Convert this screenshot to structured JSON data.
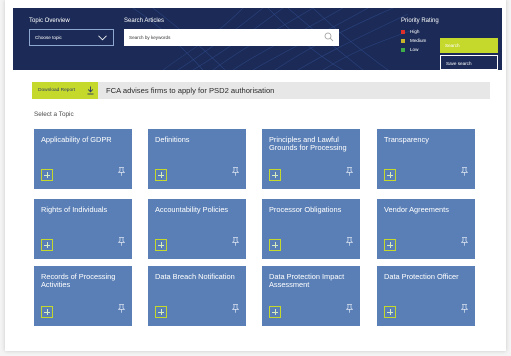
{
  "header": {
    "topic_label": "Topic Overview",
    "topic_select_value": "Choose topic",
    "search_label": "Search Articles",
    "search_placeholder": "Search by keywords",
    "priority_label": "Priority Rating",
    "priorities": [
      {
        "label": "High",
        "color": "#e0302c"
      },
      {
        "label": "Medium",
        "color": "#c8b42a"
      },
      {
        "label": "Low",
        "color": "#3fae4a"
      }
    ],
    "search_button": "Search",
    "save_search_button": "Save search"
  },
  "news": {
    "download_label": "Download Report",
    "headline": "FCA advises firms to apply for PSD2 authorisation"
  },
  "select_topic_label": "Select a Topic",
  "colors": {
    "banner": "#1b2a56",
    "accent": "#c5d82c",
    "card": "#5a7fb6"
  },
  "topics": [
    {
      "title": "Applicability of GDPR"
    },
    {
      "title": "Definitions"
    },
    {
      "title": "Principles and Lawful Grounds for Processing"
    },
    {
      "title": "Transparency"
    },
    {
      "title": "Rights of Individuals"
    },
    {
      "title": "Accountability Policies"
    },
    {
      "title": "Processor Obligations"
    },
    {
      "title": "Vendor Agreements"
    },
    {
      "title": "Records of Processing Activities"
    },
    {
      "title": "Data Breach Notification"
    },
    {
      "title": "Data Protection Impact Assessment"
    },
    {
      "title": "Data Protection Officer"
    }
  ]
}
